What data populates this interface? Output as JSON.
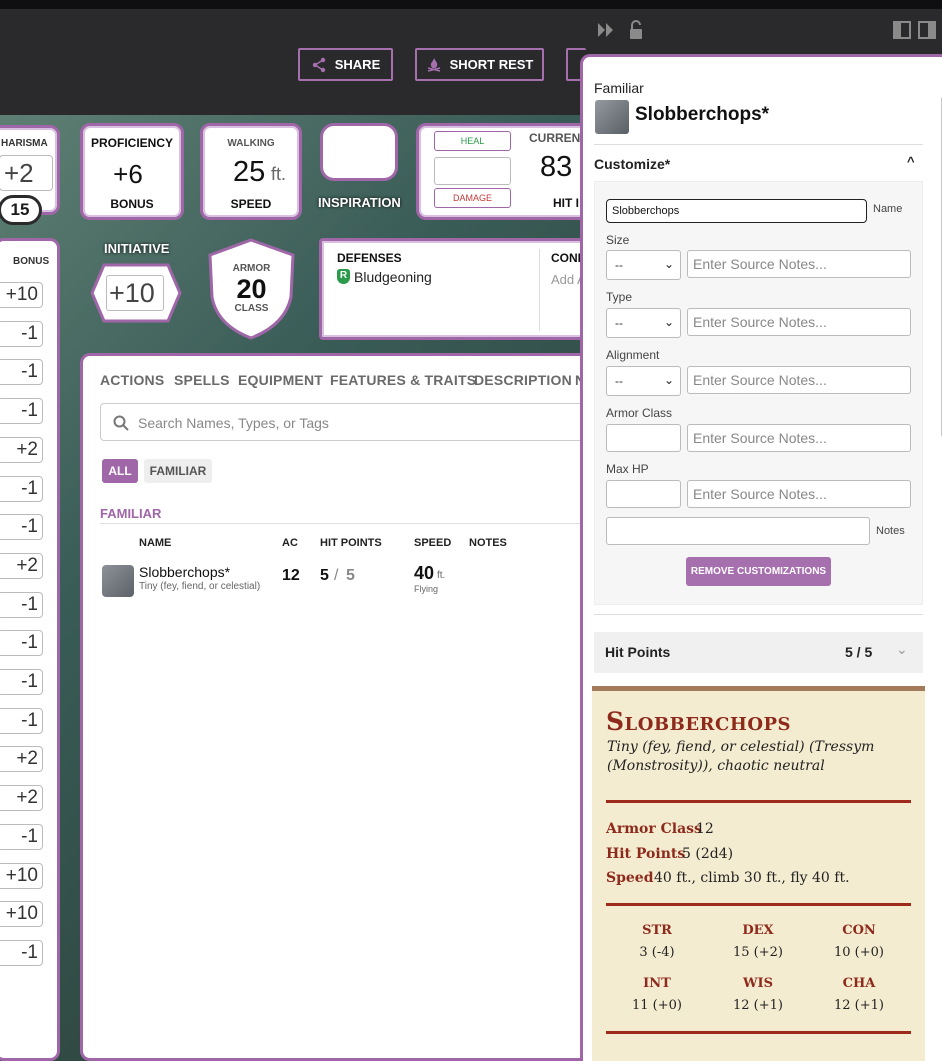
{
  "header": {
    "share_label": "SHARE",
    "short_rest_label": "SHORT REST"
  },
  "stats": {
    "charisma_label": "HARISMA",
    "charisma_mod": "+2",
    "charisma_score": "15",
    "proficiency_label": "PROFICIENCY",
    "proficiency_value": "+6",
    "proficiency_sub": "BONUS",
    "walking_label": "WALKING",
    "walking_value": "25",
    "walking_unit": "ft.",
    "speed_label": "SPEED",
    "inspiration_label": "INSPIRATION",
    "heal_label": "HEAL",
    "damage_label": "DAMAGE",
    "current_label": "CURRENT",
    "current_hp": "83",
    "hit_label": "HIT I",
    "initiative_label": "INITIATIVE",
    "initiative_value": "+10",
    "armor_label": "ARMOR",
    "armor_value": "20",
    "armor_sub": "CLASS",
    "defenses_label": "DEFENSES",
    "defense_item": "Bludgeoning",
    "conditions_label": "COND",
    "conditions_add": "Add A"
  },
  "skills": {
    "header": "BONUS",
    "values": [
      "+10",
      "-1",
      "-1",
      "-1",
      "+2",
      "-1",
      "-1",
      "+2",
      "-1",
      "-1",
      "-1",
      "-1",
      "+2",
      "+2",
      "-1",
      "+10",
      "+10",
      "-1"
    ]
  },
  "main": {
    "tabs": [
      "ACTIONS",
      "SPELLS",
      "EQUIPMENT",
      "FEATURES & TRAITS",
      "DESCRIPTION",
      "N"
    ],
    "search_placeholder": "Search Names, Types, or Tags",
    "filters": [
      "ALL",
      "FAMILIAR"
    ],
    "section_title": "FAMILIAR",
    "columns": [
      "NAME",
      "AC",
      "HIT POINTS",
      "SPEED",
      "NOTES"
    ],
    "row": {
      "name": "Slobberchops*",
      "subtitle": "Tiny (fey, fiend, or celestial)",
      "ac": "12",
      "hp_current": "5",
      "hp_sep": "/",
      "hp_max": "5",
      "speed": "40",
      "speed_unit": "ft.",
      "speed_type": "Flying"
    }
  },
  "panel": {
    "type_label": "Familiar",
    "name": "Slobberchops*",
    "customize_title": "Customize*",
    "name_value": "Slobberchops",
    "name_label": "Name",
    "size_label": "Size",
    "type_field_label": "Type",
    "alignment_label": "Alignment",
    "armor_class_label": "Armor Class",
    "max_hp_label": "Max HP",
    "notes_label": "Notes",
    "select_value": "--",
    "source_placeholder": "Enter Source Notes...",
    "remove_label": "REMOVE CUSTOMIZATIONS",
    "hp_section_label": "Hit Points",
    "hp_value": "5 / 5"
  },
  "statblock": {
    "name": "Slobberchops",
    "meta_line1": "Tiny (fey, fiend, or celestial) (Tressym",
    "meta_line2": "(Monstrosity)), chaotic neutral",
    "ac_label": "Armor Class",
    "ac_value": "12",
    "hp_label": "Hit Points",
    "hp_value": "5 (2d4)",
    "speed_label": "Speed",
    "speed_value": "40 ft., climb 30 ft., fly 40 ft.",
    "abilities": [
      {
        "name": "STR",
        "value": "3 (-4)"
      },
      {
        "name": "DEX",
        "value": "15 (+2)"
      },
      {
        "name": "CON",
        "value": "10 (+0)"
      },
      {
        "name": "INT",
        "value": "11 (+0)"
      },
      {
        "name": "WIS",
        "value": "12 (+1)"
      },
      {
        "name": "CHA",
        "value": "12 (+1)"
      }
    ]
  },
  "colors": {
    "accent": "#9f66a8",
    "statblock_red": "#8e2a1c",
    "parchment": "#f4ecd0"
  }
}
